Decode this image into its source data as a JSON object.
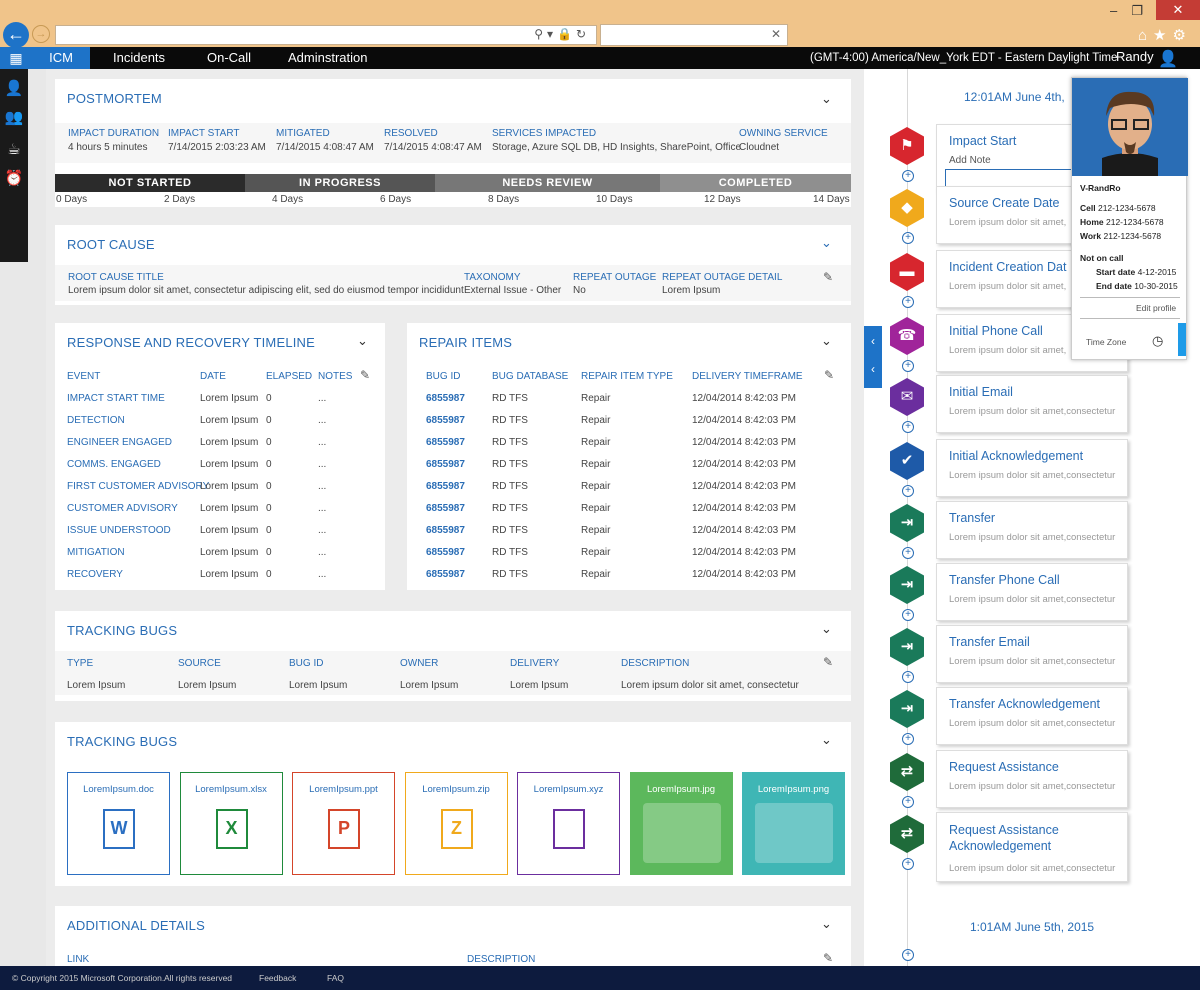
{
  "nav": {
    "logo": "ICM",
    "items": [
      "Incidents",
      "On-Call",
      "Adminstration"
    ],
    "timezone": "(GMT-4:00) America/New_York EDT - Eastern Daylight Time",
    "user": "Randy"
  },
  "postmortem": {
    "title": "POSTMORTEM",
    "fields": [
      {
        "label": "IMPACT DURATION",
        "value": "4 hours 5 minutes"
      },
      {
        "label": "IMPACT START",
        "value": "7/14/2015 2:03:23 AM"
      },
      {
        "label": "MITIGATED",
        "value": "7/14/2015 4:08:47 AM"
      },
      {
        "label": "RESOLVED",
        "value": "7/14/2015 4:08:47 AM"
      },
      {
        "label": "SERVICES IMPACTED",
        "value": "Storage, Azure SQL DB, HD Insights, SharePoint, Office"
      },
      {
        "label": "OWNING SERVICE",
        "value": "Cloudnet"
      }
    ],
    "stages": [
      "NOT STARTED",
      "IN PROGRESS",
      "NEEDS REVIEW",
      "COMPLETED"
    ],
    "days": [
      "0 Days",
      "2 Days",
      "4 Days",
      "6 Days",
      "8 Days",
      "10 Days",
      "12 Days",
      "14 Days"
    ]
  },
  "root_cause": {
    "title": "ROOT CAUSE",
    "fields": [
      {
        "label": "ROOT CAUSE TITLE",
        "value": "Lorem ipsum dolor sit amet, consectetur adipiscing elit, sed do eiusmod tempor incididunt"
      },
      {
        "label": "TAXONOMY",
        "value": "External Issue - Other"
      },
      {
        "label": "REPEAT OUTAGE",
        "value": "No"
      },
      {
        "label": "REPEAT OUTAGE DETAIL",
        "value": "Lorem Ipsum"
      }
    ]
  },
  "response": {
    "title": "RESPONSE AND RECOVERY TIMELINE",
    "headers": [
      "EVENT",
      "DATE",
      "ELAPSED",
      "NOTES"
    ],
    "rows": [
      [
        "IMPACT START TIME",
        "Lorem Ipsum",
        "0",
        "..."
      ],
      [
        "DETECTION",
        "Lorem Ipsum",
        "0",
        "..."
      ],
      [
        "ENGINEER ENGAGED",
        "Lorem Ipsum",
        "0",
        "..."
      ],
      [
        "COMMS. ENGAGED",
        "Lorem Ipsum",
        "0",
        "..."
      ],
      [
        "FIRST CUSTOMER ADVISORY",
        "Lorem Ipsum",
        "0",
        "..."
      ],
      [
        "CUSTOMER ADVISORY",
        "Lorem Ipsum",
        "0",
        "..."
      ],
      [
        "ISSUE UNDERSTOOD",
        "Lorem Ipsum",
        "0",
        "..."
      ],
      [
        "MITIGATION",
        "Lorem Ipsum",
        "0",
        "..."
      ],
      [
        "RECOVERY",
        "Lorem Ipsum",
        "0",
        "..."
      ]
    ]
  },
  "repair": {
    "title": "REPAIR ITEMS",
    "headers": [
      "BUG ID",
      "BUG DATABASE",
      "REPAIR ITEM TYPE",
      "DELIVERY TIMEFRAME"
    ],
    "rows": [
      [
        "6855987",
        "RD TFS",
        "Repair",
        "12/04/2014 8:42:03 PM"
      ],
      [
        "6855987",
        "RD TFS",
        "Repair",
        "12/04/2014 8:42:03 PM"
      ],
      [
        "6855987",
        "RD TFS",
        "Repair",
        "12/04/2014 8:42:03 PM"
      ],
      [
        "6855987",
        "RD TFS",
        "Repair",
        "12/04/2014 8:42:03 PM"
      ],
      [
        "6855987",
        "RD TFS",
        "Repair",
        "12/04/2014 8:42:03 PM"
      ],
      [
        "6855987",
        "RD TFS",
        "Repair",
        "12/04/2014 8:42:03 PM"
      ],
      [
        "6855987",
        "RD TFS",
        "Repair",
        "12/04/2014 8:42:03 PM"
      ],
      [
        "6855987",
        "RD TFS",
        "Repair",
        "12/04/2014 8:42:03 PM"
      ],
      [
        "6855987",
        "RD TFS",
        "Repair",
        "12/04/2014 8:42:03 PM"
      ]
    ]
  },
  "tracking": {
    "title": "TRACKING BUGS",
    "headers": [
      "TYPE",
      "SOURCE",
      "BUG ID",
      "OWNER",
      "DELIVERY",
      "DESCRIPTION"
    ],
    "values": [
      "Lorem Ipsum",
      "Lorem Ipsum",
      "Lorem Ipsum",
      "Lorem Ipsum",
      "Lorem Ipsum",
      "Lorem ipsum dolor sit amet, consectetur"
    ]
  },
  "attachments": {
    "title": "TRACKING BUGS",
    "files": [
      {
        "name": "LoremIpsum.doc",
        "letter": "W",
        "color": "#2b6fc2"
      },
      {
        "name": "LoremIpsum.xlsx",
        "letter": "X",
        "color": "#1f8a3b"
      },
      {
        "name": "LoremIpsum.ppt",
        "letter": "P",
        "color": "#d4452a"
      },
      {
        "name": "LoremIpsum.zip",
        "letter": "Z",
        "color": "#f0a91c"
      },
      {
        "name": "LoremIpsum.xyz",
        "letter": "",
        "color": "#6b2e9e"
      },
      {
        "name": "LoremIpsum.jpg",
        "letter": "",
        "color": "#5cb85c"
      },
      {
        "name": "LoremIpsum.png",
        "letter": "",
        "color": "#3fb6b5"
      }
    ]
  },
  "additional": {
    "title": "ADDITIONAL DETAILS",
    "headers": [
      "LINK",
      "DESCRIPTION"
    ]
  },
  "timeline": {
    "top_time": "12:01AM June 4th,",
    "bottom_time": "1:01AM June 5th, 2015",
    "add_note_label": "Add Note",
    "events": [
      {
        "title": "Impact Start",
        "sub": "",
        "icon": "map-pin-icon",
        "glyph": "⚑",
        "color": "#d7262e"
      },
      {
        "title": "Source Create Date",
        "sub": "Lorem ipsum dolor sit amet,",
        "icon": "diamond-icon",
        "glyph": "◆",
        "color": "#f0a91c"
      },
      {
        "title": "Incident Creation Dat",
        "sub": "Lorem ipsum dolor sit amet,",
        "icon": "ticket-icon",
        "glyph": "▬",
        "color": "#d7262e"
      },
      {
        "title": "Initial Phone Call",
        "sub": "Lorem ipsum dolor sit amet,",
        "icon": "phone-icon",
        "glyph": "☎",
        "color": "#a0249a"
      },
      {
        "title": "Initial Email",
        "sub": "Lorem ipsum dolor sit amet,consectetur",
        "icon": "envelope-icon",
        "glyph": "✉",
        "color": "#6b2e9e"
      },
      {
        "title": "Initial Acknowledgement",
        "sub": "Lorem ipsum dolor sit amet,consectetur",
        "icon": "checkmark-icon",
        "glyph": "✔",
        "color": "#1e5aa8"
      },
      {
        "title": "Transfer",
        "sub": "Lorem ipsum dolor sit amet,consectetur",
        "icon": "transfer-icon",
        "glyph": "⇥",
        "color": "#1a7a5a"
      },
      {
        "title": "Transfer Phone Call",
        "sub": "Lorem ipsum dolor sit amet,consectetur",
        "icon": "transfer-icon",
        "glyph": "⇥",
        "color": "#1a7a5a"
      },
      {
        "title": "Transfer Email",
        "sub": "Lorem ipsum dolor sit amet,consectetur",
        "icon": "transfer-icon",
        "glyph": "⇥",
        "color": "#1a7a5a"
      },
      {
        "title": "Transfer Acknowledgement",
        "sub": "Lorem ipsum dolor sit amet,consectetur",
        "icon": "transfer-icon",
        "glyph": "⇥",
        "color": "#1a7a5a"
      },
      {
        "title": "Request Assistance",
        "sub": "Lorem ipsum dolor sit amet,consectetur",
        "icon": "swap-arrows-icon",
        "glyph": "⇄",
        "color": "#1f6b3a"
      },
      {
        "title": "Request Assistance Acknowledgement",
        "sub": "Lorem ipsum dolor sit amet,consectetur",
        "icon": "swap-arrows-icon",
        "glyph": "⇄",
        "color": "#1f6b3a"
      }
    ]
  },
  "profile": {
    "name": "V-RandRo",
    "cell_label": "Cell",
    "cell": "212-1234-5678",
    "home_label": "Home",
    "home": "212-1234-5678",
    "work_label": "Work",
    "work": "212-1234-5678",
    "status": "Not on call",
    "start_label": "Start date",
    "start": "4-12-2015",
    "end_label": "End date",
    "end": "10-30-2015",
    "edit": "Edit profile",
    "timezone": "Time Zone"
  },
  "footer": {
    "copyright": "© Copyright 2015 Microsoft Corporation.",
    "rights": "All rights reserved",
    "feedback": "Feedback",
    "faq": "FAQ"
  },
  "colors": {
    "accent": "#2a6db5",
    "nav_blue": "#1e73c8",
    "stage_dark": "#2b2b2b",
    "stage_mid": "#555555",
    "stage_light": "#777777",
    "stage_lighter": "#8f8f8f"
  }
}
